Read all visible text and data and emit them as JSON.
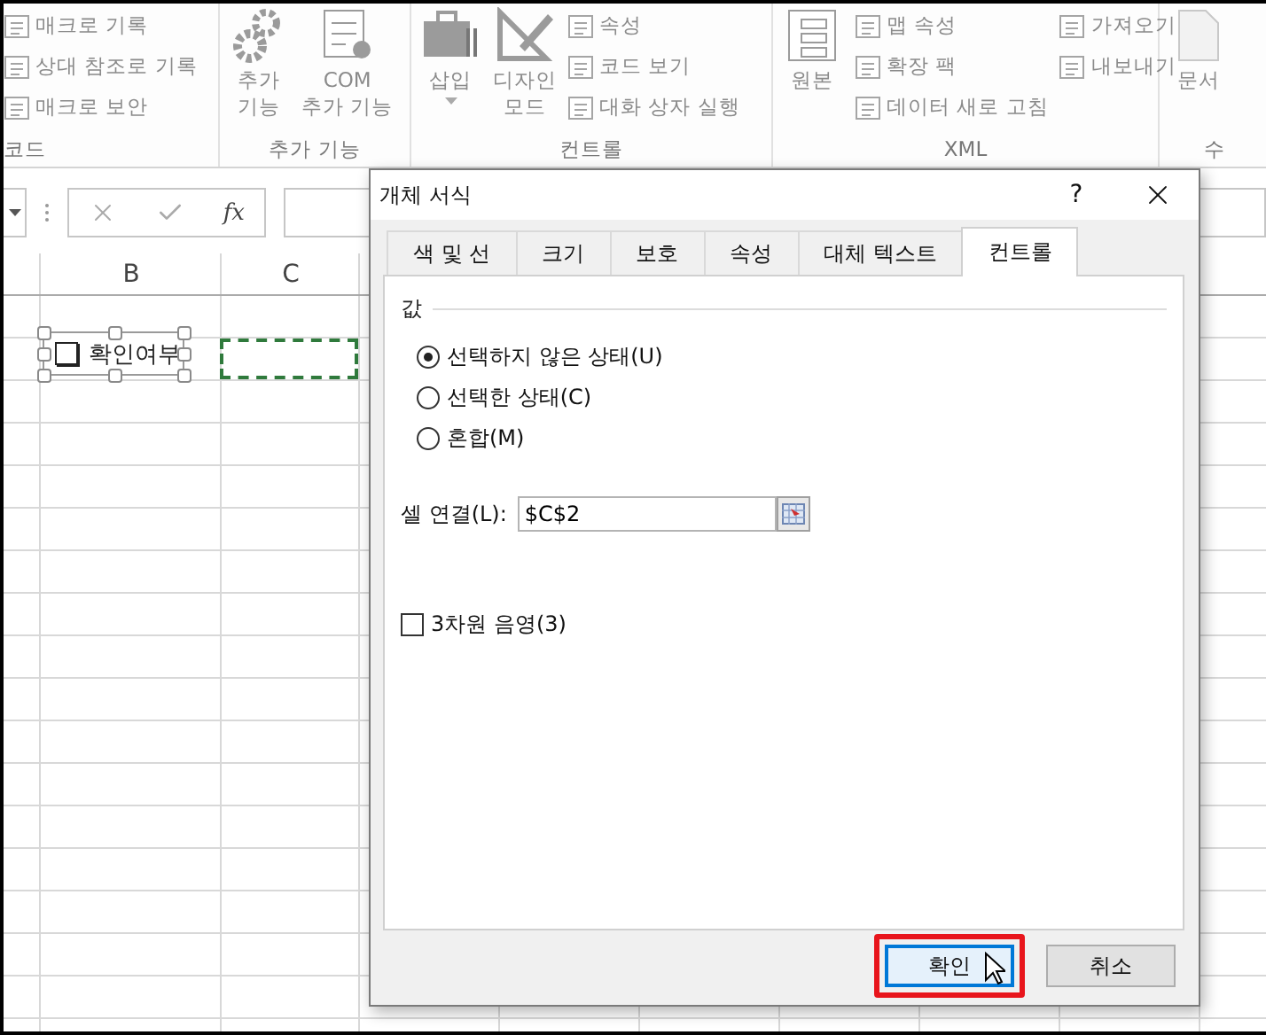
{
  "ribbon": {
    "disabled": true,
    "groups": [
      {
        "label": "코드",
        "items": [
          {
            "kind": "small",
            "label": "매크로 기록"
          },
          {
            "kind": "small",
            "label": "상대 참조로 기록"
          },
          {
            "kind": "small",
            "label": "매크로 보안"
          }
        ]
      },
      {
        "label": "추가 기능",
        "items": [
          {
            "kind": "large",
            "label": "추가\n기능",
            "has_menu": false
          },
          {
            "kind": "large",
            "label": "COM\n추가 기능",
            "has_menu": false
          }
        ]
      },
      {
        "label": "컨트롤",
        "items": [
          {
            "kind": "large",
            "label": "삽입",
            "has_menu": true
          },
          {
            "kind": "large",
            "label": "디자인\n모드",
            "has_menu": false
          },
          {
            "kind": "small",
            "label": "속성"
          },
          {
            "kind": "small",
            "label": "코드 보기"
          },
          {
            "kind": "small",
            "label": "대화 상자 실행"
          }
        ]
      },
      {
        "label": "XML",
        "items": [
          {
            "kind": "large",
            "label": "원본",
            "has_menu": false
          },
          {
            "kind": "small",
            "label": "맵 속성"
          },
          {
            "kind": "small",
            "label": "확장 팩"
          },
          {
            "kind": "small",
            "label": "데이터 새로 고침"
          },
          {
            "kind": "small",
            "label": "가져오기"
          },
          {
            "kind": "small",
            "label": "내보내기"
          }
        ]
      },
      {
        "label": "수",
        "items": [
          {
            "kind": "large",
            "label": "문서",
            "has_menu": false
          }
        ]
      }
    ]
  },
  "formula_bar": {
    "function_label": "fx"
  },
  "sheet": {
    "column_headers": [
      "B",
      "C"
    ],
    "checkbox_control": {
      "label": "확인여부",
      "checked": false,
      "selected": true
    }
  },
  "dialog": {
    "title": "개체 서식",
    "help": "?",
    "tabs": [
      {
        "label": "색 및 선",
        "selected": false
      },
      {
        "label": "크기",
        "selected": false
      },
      {
        "label": "보호",
        "selected": false
      },
      {
        "label": "속성",
        "selected": false
      },
      {
        "label": "대체 텍스트",
        "selected": false
      },
      {
        "label": "컨트롤",
        "selected": true
      }
    ],
    "group_label": "값",
    "options": [
      {
        "label": "선택하지 않은 상태(U)",
        "selected": true
      },
      {
        "label": "선택한 상태(C)",
        "selected": false
      },
      {
        "label": "혼합(M)",
        "selected": false
      }
    ],
    "cell_link": {
      "label": "셀 연결(L):",
      "value": "$C$2"
    },
    "shading": {
      "label": "3차원 음영(3)",
      "checked": false
    },
    "buttons": [
      {
        "label": "확인",
        "default": true,
        "highlighted": true
      },
      {
        "label": "취소",
        "default": false,
        "highlighted": false
      }
    ]
  }
}
